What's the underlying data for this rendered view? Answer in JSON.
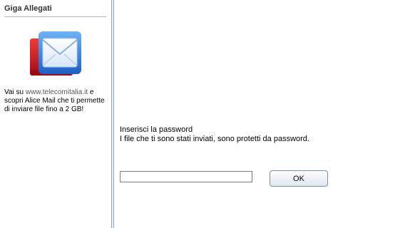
{
  "sidebar": {
    "title": "Giga Allegati",
    "text_prefix": "Vai su ",
    "link_text": "www.telecomitalia.it",
    "text_suffix": " e scopri Alice Mail che ti permette di inviare file fino a 2 GB!",
    "logo_icon": "mail-envelope-icon"
  },
  "main": {
    "title": "Inserisci la password",
    "subtitle": "I file che ti sono stati inviati, sono protetti da password.",
    "password_value": "",
    "ok_label": "OK"
  },
  "colors": {
    "separator": "#8ba6c9",
    "logo_red": "#c8141e",
    "logo_blue": "#3b82d8"
  }
}
